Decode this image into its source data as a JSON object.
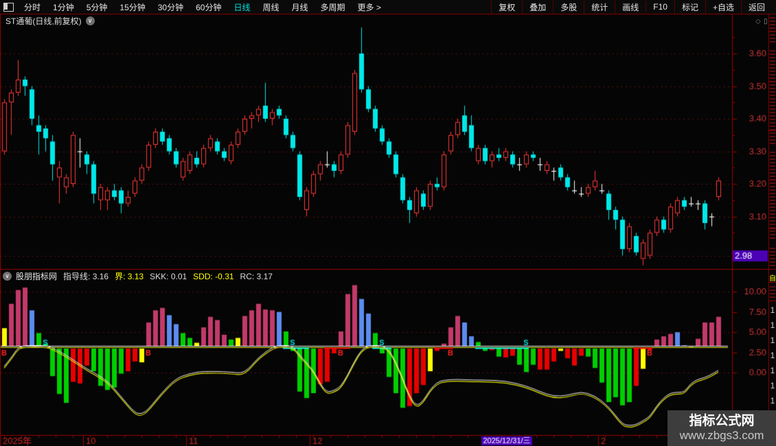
{
  "toolbar": {
    "left_items": [
      "分时",
      "1分钟",
      "5分钟",
      "15分钟",
      "30分钟",
      "60分钟",
      "日线",
      "周线",
      "月线",
      "多周期",
      "更多 >"
    ],
    "active_item": "日线",
    "right_items": [
      "复权",
      "叠加",
      "多股",
      "统计",
      "画线",
      "F10",
      "标记",
      "+自选",
      "返回"
    ]
  },
  "title": {
    "text": "ST通葡(日线,前复权)"
  },
  "indicator_header": {
    "source": "股朋指标网",
    "fields": [
      {
        "label": "指导线:",
        "value": "3.16",
        "color": "#f0f0f0"
      },
      {
        "label": "界:",
        "value": "3.13",
        "color": "#ffff00"
      },
      {
        "label": "SKK:",
        "value": "0.01",
        "color": "#f0f0f0"
      },
      {
        "label": "SDD:",
        "value": "-0.31",
        "color": "#ffff00"
      },
      {
        "label": "RC:",
        "value": "3.17",
        "color": "#f0f0f0"
      }
    ]
  },
  "watermark": {
    "line1": "指标公式网",
    "line2": "www.zbgs3.com"
  },
  "right_strip": {
    "tab_char": "自",
    "ones": [
      "1",
      "1",
      "1",
      "1",
      "1",
      "1",
      "1"
    ]
  },
  "colors": {
    "up": "#ff3838",
    "down": "#00e8e8",
    "doji": "#ffffff",
    "rose": "#c23a6a",
    "blue": "#5c8cf0",
    "green": "#00cf00",
    "red_bar": "#e80000",
    "yellow": "#ffff00",
    "axis_text": "#c83232",
    "grid": "#7a1414",
    "frame": "#9b0000",
    "highlight_bg": "#4b00b4",
    "accent": "#00e0e0",
    "line_yellow": "#e8e800",
    "line_white": "#f0f0f0",
    "signal_buy": "#ff2020",
    "signal_sell": "#00d8d8"
  },
  "chart_data": {
    "type": "candlestick+histogram",
    "main": {
      "type": "candlestick",
      "y_ticks": [
        {
          "label": "3.60",
          "price": 3.6
        },
        {
          "label": "3.50",
          "price": 3.5
        },
        {
          "label": "3.40",
          "price": 3.4
        },
        {
          "label": "3.30",
          "price": 3.3
        },
        {
          "label": "3.20",
          "price": 3.2
        },
        {
          "label": "3.10",
          "price": 3.1
        },
        {
          "label": "2.98",
          "price": 2.98,
          "highlight": true
        }
      ],
      "minor_tick_prices": [
        3.65,
        3.55,
        3.45,
        3.35,
        3.25,
        3.15,
        3.05
      ],
      "x_ticks": [
        {
          "label": "2025年",
          "i": 0,
          "type": "year"
        },
        {
          "label": "10",
          "i": 12,
          "type": "month"
        },
        {
          "label": "11",
          "i": 27,
          "type": "month"
        },
        {
          "label": "12",
          "i": 45,
          "type": "month"
        },
        {
          "label": "2025/12/31/三",
          "i": 70,
          "type": "tag"
        },
        {
          "label": "2",
          "i": 87,
          "type": "month"
        }
      ],
      "candles": [
        [
          3.3,
          3.46,
          3.29,
          3.45
        ],
        [
          3.45,
          3.49,
          3.35,
          3.48
        ],
        [
          3.48,
          3.58,
          3.47,
          3.52
        ],
        [
          3.52,
          3.53,
          3.47,
          3.5
        ],
        [
          3.49,
          3.5,
          3.38,
          3.4
        ],
        [
          3.38,
          3.41,
          3.29,
          3.36
        ],
        [
          3.37,
          3.38,
          3.3,
          3.34
        ],
        [
          3.33,
          3.35,
          3.21,
          3.26
        ],
        [
          3.22,
          3.27,
          3.14,
          3.25
        ],
        [
          3.19,
          3.23,
          3.17,
          3.22
        ],
        [
          3.2,
          3.36,
          3.19,
          3.35
        ],
        [
          3.3,
          3.34,
          3.25,
          3.3
        ],
        [
          3.29,
          3.3,
          3.23,
          3.26
        ],
        [
          3.26,
          3.27,
          3.14,
          3.17
        ],
        [
          3.15,
          3.2,
          3.12,
          3.19
        ],
        [
          3.15,
          3.19,
          3.12,
          3.18
        ],
        [
          3.18,
          3.2,
          3.15,
          3.16
        ],
        [
          3.18,
          3.19,
          3.11,
          3.14
        ],
        [
          3.14,
          3.18,
          3.13,
          3.16
        ],
        [
          3.17,
          3.22,
          3.16,
          3.21
        ],
        [
          3.21,
          3.26,
          3.2,
          3.25
        ],
        [
          3.25,
          3.33,
          3.24,
          3.32
        ],
        [
          3.32,
          3.37,
          3.31,
          3.36
        ],
        [
          3.36,
          3.37,
          3.32,
          3.33
        ],
        [
          3.34,
          3.35,
          3.29,
          3.3
        ],
        [
          3.3,
          3.31,
          3.25,
          3.26
        ],
        [
          3.22,
          3.28,
          3.21,
          3.27
        ],
        [
          3.24,
          3.3,
          3.23,
          3.29
        ],
        [
          3.28,
          3.3,
          3.25,
          3.26
        ],
        [
          3.26,
          3.32,
          3.25,
          3.31
        ],
        [
          3.31,
          3.35,
          3.3,
          3.34
        ],
        [
          3.33,
          3.34,
          3.29,
          3.3
        ],
        [
          3.3,
          3.31,
          3.27,
          3.28
        ],
        [
          3.27,
          3.33,
          3.26,
          3.32
        ],
        [
          3.32,
          3.37,
          3.31,
          3.36
        ],
        [
          3.36,
          3.41,
          3.35,
          3.4
        ],
        [
          3.4,
          3.42,
          3.37,
          3.41
        ],
        [
          3.41,
          3.44,
          3.39,
          3.43
        ],
        [
          3.44,
          3.51,
          3.39,
          3.4
        ],
        [
          3.4,
          3.43,
          3.38,
          3.42
        ],
        [
          3.43,
          3.44,
          3.4,
          3.41
        ],
        [
          3.4,
          3.41,
          3.34,
          3.35
        ],
        [
          3.35,
          3.36,
          3.3,
          3.31
        ],
        [
          3.29,
          3.3,
          3.15,
          3.16
        ],
        [
          3.12,
          3.19,
          3.1,
          3.18
        ],
        [
          3.17,
          3.24,
          3.16,
          3.23
        ],
        [
          3.23,
          3.27,
          3.21,
          3.26
        ],
        [
          3.26,
          3.3,
          3.25,
          3.26
        ],
        [
          3.26,
          3.27,
          3.22,
          3.24
        ],
        [
          3.24,
          3.3,
          3.23,
          3.29
        ],
        [
          3.29,
          3.39,
          3.28,
          3.38
        ],
        [
          3.36,
          3.55,
          3.35,
          3.54
        ],
        [
          3.6,
          3.68,
          3.48,
          3.49
        ],
        [
          3.49,
          3.5,
          3.42,
          3.43
        ],
        [
          3.43,
          3.44,
          3.36,
          3.37
        ],
        [
          3.37,
          3.38,
          3.32,
          3.33
        ],
        [
          3.33,
          3.34,
          3.28,
          3.29
        ],
        [
          3.29,
          3.3,
          3.22,
          3.23
        ],
        [
          3.22,
          3.23,
          3.14,
          3.15
        ],
        [
          3.15,
          3.16,
          3.08,
          3.12
        ],
        [
          3.11,
          3.19,
          3.1,
          3.18
        ],
        [
          3.17,
          3.18,
          3.12,
          3.13
        ],
        [
          3.13,
          3.21,
          3.12,
          3.2
        ],
        [
          3.2,
          3.22,
          3.18,
          3.19
        ],
        [
          3.19,
          3.3,
          3.18,
          3.29
        ],
        [
          3.3,
          3.36,
          3.29,
          3.35
        ],
        [
          3.35,
          3.4,
          3.34,
          3.39
        ],
        [
          3.41,
          3.44,
          3.35,
          3.36
        ],
        [
          3.38,
          3.41,
          3.3,
          3.31
        ],
        [
          3.27,
          3.32,
          3.26,
          3.31
        ],
        [
          3.31,
          3.32,
          3.26,
          3.27
        ],
        [
          3.27,
          3.3,
          3.25,
          3.29
        ],
        [
          3.29,
          3.31,
          3.27,
          3.28
        ],
        [
          3.28,
          3.31,
          3.27,
          3.3
        ],
        [
          3.29,
          3.3,
          3.25,
          3.26
        ],
        [
          3.26,
          3.28,
          3.24,
          3.26
        ],
        [
          3.26,
          3.3,
          3.25,
          3.29
        ],
        [
          3.29,
          3.3,
          3.27,
          3.28
        ],
        [
          3.26,
          3.28,
          3.24,
          3.26
        ],
        [
          3.24,
          3.27,
          3.23,
          3.26
        ],
        [
          3.24,
          3.25,
          3.21,
          3.24
        ],
        [
          3.25,
          3.26,
          3.21,
          3.22
        ],
        [
          3.22,
          3.23,
          3.18,
          3.19
        ],
        [
          3.18,
          3.21,
          3.17,
          3.18
        ],
        [
          3.17,
          3.19,
          3.16,
          3.17
        ],
        [
          3.17,
          3.2,
          3.16,
          3.19
        ],
        [
          3.19,
          3.24,
          3.18,
          3.21
        ],
        [
          3.18,
          3.2,
          3.17,
          3.18
        ],
        [
          3.17,
          3.18,
          3.09,
          3.12
        ],
        [
          3.12,
          3.13,
          3.06,
          3.09
        ],
        [
          3.09,
          3.1,
          2.98,
          3.0
        ],
        [
          3.0,
          3.08,
          2.99,
          3.07
        ],
        [
          3.04,
          3.05,
          2.98,
          2.99
        ],
        [
          2.97,
          3.03,
          2.95,
          3.02
        ],
        [
          2.98,
          3.06,
          2.97,
          3.05
        ],
        [
          3.05,
          3.1,
          3.04,
          3.09
        ],
        [
          3.09,
          3.1,
          3.05,
          3.06
        ],
        [
          3.06,
          3.14,
          3.05,
          3.13
        ],
        [
          3.11,
          3.16,
          3.1,
          3.15
        ],
        [
          3.15,
          3.16,
          3.12,
          3.13
        ],
        [
          3.14,
          3.16,
          3.13,
          3.14
        ],
        [
          3.14,
          3.15,
          3.12,
          3.14
        ],
        [
          3.14,
          3.15,
          3.06,
          3.08
        ],
        [
          3.1,
          3.11,
          3.07,
          3.1
        ],
        [
          3.16,
          3.22,
          3.15,
          3.21
        ]
      ]
    },
    "indicator": {
      "type": "histogram+lines",
      "baseline_value": 3.16,
      "baseline_lines": [
        {
          "name": "指导线",
          "value": 3.16,
          "color": "#f0f0f0"
        },
        {
          "name": "界",
          "value": 3.13,
          "color": "#e8e800"
        }
      ],
      "y_ticks": [
        {
          "label": "10.00",
          "value": 10.0
        },
        {
          "label": "7.50",
          "value": 7.5
        },
        {
          "label": "5.00",
          "value": 5.0
        },
        {
          "label": "2.50",
          "value": 2.5
        },
        {
          "label": "0.00",
          "value": 0.0
        }
      ],
      "grid_values": [
        10.0,
        5.0,
        0.0
      ],
      "bar_values": [
        5.5,
        8.5,
        10.2,
        10.5,
        7.7,
        4.9,
        3.6,
        -0.4,
        -2.6,
        -3.7,
        -1.1,
        -1.3,
        0.9,
        0.2,
        -1.6,
        -2.1,
        -1.8,
        -0.1,
        0.2,
        1.4,
        1.3,
        6.2,
        7.7,
        8.0,
        7.1,
        6.0,
        4.9,
        4.3,
        3.7,
        5.6,
        6.9,
        6.5,
        4.7,
        4.1,
        4.3,
        7.0,
        7.7,
        8.5,
        7.8,
        7.7,
        7.5,
        5.1,
        2.7,
        -2.3,
        -3.1,
        -2.5,
        -1.4,
        -1.1,
        2.4,
        5.1,
        9.7,
        10.8,
        9.1,
        7.3,
        4.9,
        2.4,
        -0.5,
        -2.5,
        -4.3,
        -4.1,
        -2.5,
        -1.5,
        0.2,
        2.7,
        3.6,
        5.6,
        7.0,
        6.2,
        4.5,
        3.8,
        2.7,
        2.8,
        2.0,
        1.9,
        2.1,
        1.0,
        0.1,
        1.0,
        0.4,
        0.4,
        1.4,
        2.7,
        1.8,
        0.9,
        2.1,
        2.0,
        0.6,
        -1.2,
        -3.6,
        -3.0,
        -4.0,
        -3.6,
        -1.6,
        0.5,
        2.8,
        4.1,
        4.5,
        4.8,
        5.0,
        3.4,
        3.3,
        4.2,
        6.2,
        6.2,
        6.9
      ],
      "bar_colors": "yrrrbgggggRRRgggggRRyrrrbbggyrrrrgyrrrrrbgggggRRRrrrbbgggggRRRyRrrrbbggRgRRgggRRRyRRRgggggggRyRrrrbbyrrrr",
      "line_points": [
        [
          0,
          0.6
        ],
        [
          1,
          1.6
        ],
        [
          2,
          2.9
        ],
        [
          3,
          3.16
        ],
        [
          6,
          3.16
        ],
        [
          7,
          2.9
        ],
        [
          9,
          2.0
        ],
        [
          12,
          0.3
        ],
        [
          15,
          -1.1
        ],
        [
          17,
          -3.1
        ],
        [
          19,
          -5.1
        ],
        [
          20,
          -5.3
        ],
        [
          21,
          -4.7
        ],
        [
          23,
          -2.6
        ],
        [
          25,
          -0.9
        ],
        [
          27,
          -0.3
        ],
        [
          29,
          0.0
        ],
        [
          33,
          -0.1
        ],
        [
          35,
          -0.3
        ],
        [
          37,
          1.7
        ],
        [
          39,
          2.9
        ],
        [
          40,
          3.16
        ],
        [
          42,
          3.16
        ],
        [
          43,
          2.0
        ],
        [
          45,
          0.2
        ],
        [
          46,
          -1.5
        ],
        [
          47,
          -2.6
        ],
        [
          48,
          -2.4
        ],
        [
          49,
          -1.9
        ],
        [
          50,
          -0.5
        ],
        [
          51,
          1.2
        ],
        [
          52,
          2.6
        ],
        [
          53,
          3.16
        ],
        [
          55,
          3.16
        ],
        [
          56,
          2.7
        ],
        [
          57,
          1.2
        ],
        [
          58,
          -0.8
        ],
        [
          59,
          -3.0
        ],
        [
          60,
          -4.3
        ],
        [
          61,
          -3.7
        ],
        [
          62,
          -2.3
        ],
        [
          63,
          -1.4
        ],
        [
          64,
          -1.1
        ],
        [
          66,
          -1.0
        ],
        [
          68,
          -1.1
        ],
        [
          70,
          -1.1
        ],
        [
          73,
          -1.2
        ],
        [
          76,
          -1.8
        ],
        [
          78,
          -2.5
        ],
        [
          80,
          -3.1
        ],
        [
          82,
          -3.0
        ],
        [
          84,
          -2.5
        ],
        [
          86,
          -3.0
        ],
        [
          88,
          -4.3
        ],
        [
          90,
          -6.5
        ],
        [
          91,
          -6.7
        ],
        [
          92,
          -6.6
        ],
        [
          93,
          -6.1
        ],
        [
          94,
          -5.6
        ],
        [
          95,
          -4.3
        ],
        [
          96,
          -3.3
        ],
        [
          97,
          -2.7
        ],
        [
          98,
          -2.6
        ],
        [
          99,
          -2.6
        ],
        [
          100,
          -1.5
        ],
        [
          101,
          -1.0
        ],
        [
          102,
          -0.8
        ],
        [
          103,
          -0.4
        ],
        [
          104,
          0.1
        ]
      ],
      "signals": [
        {
          "i": 0,
          "t": "B"
        },
        {
          "i": 6,
          "t": "S"
        },
        {
          "i": 21,
          "t": "B"
        },
        {
          "i": 42,
          "t": "S"
        },
        {
          "i": 49,
          "t": "B"
        },
        {
          "i": 55,
          "t": "S"
        },
        {
          "i": 65,
          "t": "B"
        },
        {
          "i": 76,
          "t": "S"
        },
        {
          "i": 94,
          "t": "B"
        }
      ],
      "cyan_segments": [
        [
          41,
          44
        ],
        [
          54,
          56
        ],
        [
          69,
          76
        ]
      ],
      "red_segments": [
        [
          47,
          50
        ],
        [
          63,
          65
        ],
        [
          92,
          94
        ]
      ]
    }
  }
}
